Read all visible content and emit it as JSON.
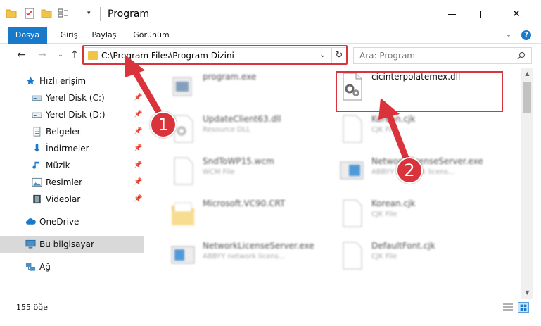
{
  "window": {
    "title": "Program",
    "icons": [
      "folder-icon",
      "properties-icon",
      "new-folder-icon",
      "view-options-icon"
    ]
  },
  "ribbon": {
    "tabs": [
      "Dosya",
      "Giriş",
      "Paylaş",
      "Görünüm"
    ],
    "help": "?"
  },
  "nav": {
    "address": "C:\\Program Files\\Program Dizini",
    "search_placeholder": "Ara: Program"
  },
  "sidebar": {
    "items": [
      {
        "label": "Hızlı erişim",
        "icon": "star-icon",
        "pinned": false
      },
      {
        "label": "Yerel Disk (C:)",
        "icon": "drive-icon",
        "pinned": true
      },
      {
        "label": "Yerel Disk (D:)",
        "icon": "drive-icon",
        "pinned": true
      },
      {
        "label": "Belgeler",
        "icon": "document-icon",
        "pinned": true
      },
      {
        "label": "İndirmeler",
        "icon": "download-icon",
        "pinned": true
      },
      {
        "label": "Müzik",
        "icon": "music-icon",
        "pinned": true
      },
      {
        "label": "Resimler",
        "icon": "pictures-icon",
        "pinned": true
      },
      {
        "label": "Videolar",
        "icon": "video-icon",
        "pinned": true
      },
      {
        "label": "OneDrive",
        "icon": "cloud-icon",
        "pinned": false
      },
      {
        "label": "Bu bilgisayar",
        "icon": "computer-icon",
        "pinned": false,
        "selected": true
      },
      {
        "label": "Ağ",
        "icon": "network-icon",
        "pinned": false
      }
    ]
  },
  "files": [
    {
      "name": "program.exe",
      "type": "",
      "icon": "exe-icon"
    },
    {
      "name": "cicinterpolatemex.dll",
      "type": "",
      "icon": "dll-gear-icon"
    },
    {
      "name": "UpdateClient63.dll",
      "type": "Resource DLL",
      "icon": "dll-icon"
    },
    {
      "name": "Korean.cjk",
      "type": "CJK File",
      "icon": "file-icon"
    },
    {
      "name": "SndToWP15.wcm",
      "type": "WCM File",
      "icon": "file-icon"
    },
    {
      "name": "NetworkLicenseServer.exe",
      "type": "ABBYY Network licens...",
      "icon": "window-app-icon"
    },
    {
      "name": "Microsoft.VC90.CRT",
      "type": "",
      "icon": "folder-icon"
    },
    {
      "name": "Korean.cjk",
      "type": "CJK File",
      "icon": "file-icon"
    },
    {
      "name": "NetworkLicenseServer.exe",
      "type": "ABBYY network licens...",
      "icon": "window-app-icon"
    },
    {
      "name": "DefaultFont.cjk",
      "type": "CJK File",
      "icon": "file-icon"
    }
  ],
  "status": {
    "count": "155 öğe"
  },
  "callouts": [
    "1",
    "2"
  ],
  "colors": {
    "accent": "#1979ca",
    "highlight": "#d9343b",
    "selected": "#d9d9d9"
  }
}
